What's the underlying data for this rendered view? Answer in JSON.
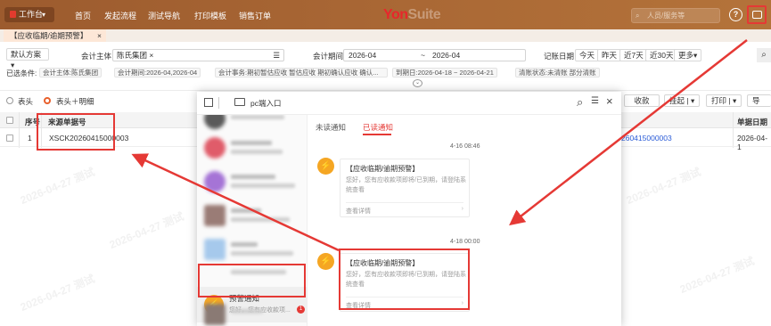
{
  "topbar": {
    "workspace": "工作台",
    "nav": [
      "首页",
      "发起流程",
      "测试导航",
      "打印模板",
      "销售订单"
    ],
    "logo_a": "Yon",
    "logo_b": "Suite",
    "search_placeholder": "人员/服务等",
    "help": "?"
  },
  "tab": {
    "label": "【应收临期/逾期预警】",
    "close": "×"
  },
  "filters": {
    "scheme": "默认方案",
    "org_label": "会计主体",
    "org_value": "陈氏集团",
    "period_label": "会计期间",
    "period_from": "2026-04",
    "period_to": "2026-04",
    "range_sep": "~",
    "date_label": "记账日期",
    "quick": [
      "今天",
      "昨天",
      "近7天",
      "近30天",
      "更多"
    ],
    "selected_label": "已选条件:",
    "chips": [
      "会计主体:陈氏集团",
      "会计期间:2026-04,2026-04",
      "会计事务:期初暂估应收 暂估应收 期初确认应收 确认...",
      "到期日:2026-04-18 ~ 2026-04-21",
      "清账状态:未清账 部分清账"
    ]
  },
  "view": {
    "radio1": "表头",
    "radio2": "表头＋明细"
  },
  "toolbar": {
    "btn_a": "收款",
    "btn_b": "挂起",
    "btn_c": "打印",
    "btn_d": "导出"
  },
  "table": {
    "headers": [
      "序号",
      "来源单据号",
      "单据日期"
    ],
    "row": {
      "index": "1",
      "source": "XSCK20260415000003",
      "mid": "260415000003",
      "date": "2026-04-1"
    }
  },
  "watermark": "2026-04-27 测试",
  "popup": {
    "title": "pc端入口",
    "tabs": [
      "未读通知",
      "已读通知"
    ],
    "selected_item_title": "预警通知",
    "selected_item_preview": "您好，您有应收款项...",
    "selected_badge": "1",
    "notifications": [
      {
        "time": "4-16 08:46",
        "title": "【应收临期/逾期预警】",
        "body": "您好，您有应收款项即将/已到期，请登陆系统查看",
        "link": "查看详情"
      },
      {
        "time": "4-18 00:00",
        "title": "【应收临期/逾期预警】",
        "body": "您好，您有应收款项即将/已到期，请登陆系统查看",
        "link": "查看详情"
      }
    ]
  },
  "colors": {
    "brand_bar": "#a86634",
    "accent": "#e8602c",
    "highlight": "#e53935",
    "warn": "#f5a623"
  }
}
